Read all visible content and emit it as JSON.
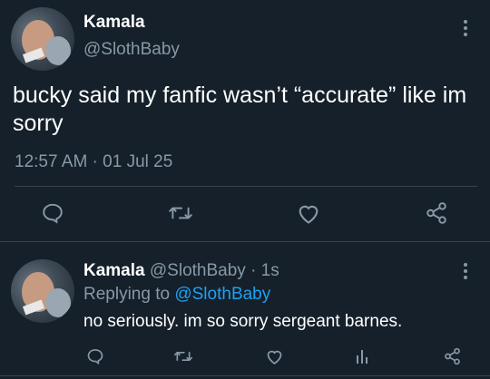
{
  "tweet": {
    "display_name": "Kamala",
    "handle": "@SlothBaby",
    "text_line1": "bucky said my fanfic wasn’t “accurate” like im",
    "text_line2": "sorry",
    "timestamp": "12:57 AM · 01 Jul 25"
  },
  "reply": {
    "display_name": "Kamala",
    "handle_time": "@SlothBaby · 1s",
    "replying_prefix": "Replying to",
    "replying_handle": "@SlothBaby",
    "text": "no seriously. im so sorry sergeant barnes."
  },
  "colors": {
    "background": "#15202b",
    "text": "#ffffff",
    "muted": "#8899a6",
    "link": "#1da1f2",
    "divider": "#38444d"
  },
  "icons": [
    "comment-icon",
    "retweet-icon",
    "like-icon",
    "share-icon",
    "analytics-icon",
    "more-icon"
  ]
}
